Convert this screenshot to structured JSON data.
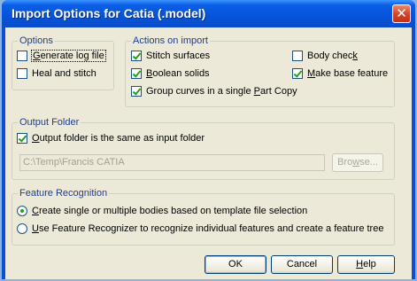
{
  "window": {
    "title": "Import Options for Catia (.model)"
  },
  "options": {
    "legend": "Options",
    "generate_log": {
      "pre": "",
      "key": "G",
      "post": "enerate log file",
      "checked": false
    },
    "heal_stitch": {
      "label": "Heal and stitch",
      "checked": false
    }
  },
  "actions": {
    "legend": "Actions on import",
    "stitch": {
      "label": "Stitch surfaces",
      "checked": true
    },
    "boolean": {
      "pre": "",
      "key": "B",
      "post": "oolean solids",
      "checked": true
    },
    "group_curves": {
      "pre": "Group curves in a single ",
      "key": "P",
      "post": "art Copy",
      "checked": true
    },
    "body_check": {
      "pre": "Body chec",
      "key": "k",
      "post": "",
      "checked": false
    },
    "make_base": {
      "pre": "",
      "key": "M",
      "post": "ake base feature",
      "checked": true
    }
  },
  "output": {
    "legend": "Output Folder",
    "same_folder": {
      "pre": "",
      "key": "O",
      "post": "utput folder is the same as input folder",
      "checked": true
    },
    "path_value": "C:\\Temp\\Francis CATIA",
    "browse": {
      "pre": "Bro",
      "key": "w",
      "post": "se..."
    }
  },
  "feature": {
    "legend": "Feature Recognition",
    "create_bodies": {
      "pre": "",
      "key": "C",
      "post": "reate single or multiple bodies based on template file selection",
      "selected": true
    },
    "use_recognizer": {
      "pre": "",
      "key": "U",
      "post": "se Feature Recognizer to recognize individual features and create a feature tree",
      "selected": false
    }
  },
  "buttons": {
    "ok": "OK",
    "cancel": "Cancel",
    "help": {
      "pre": "",
      "key": "H",
      "post": "elp"
    }
  }
}
